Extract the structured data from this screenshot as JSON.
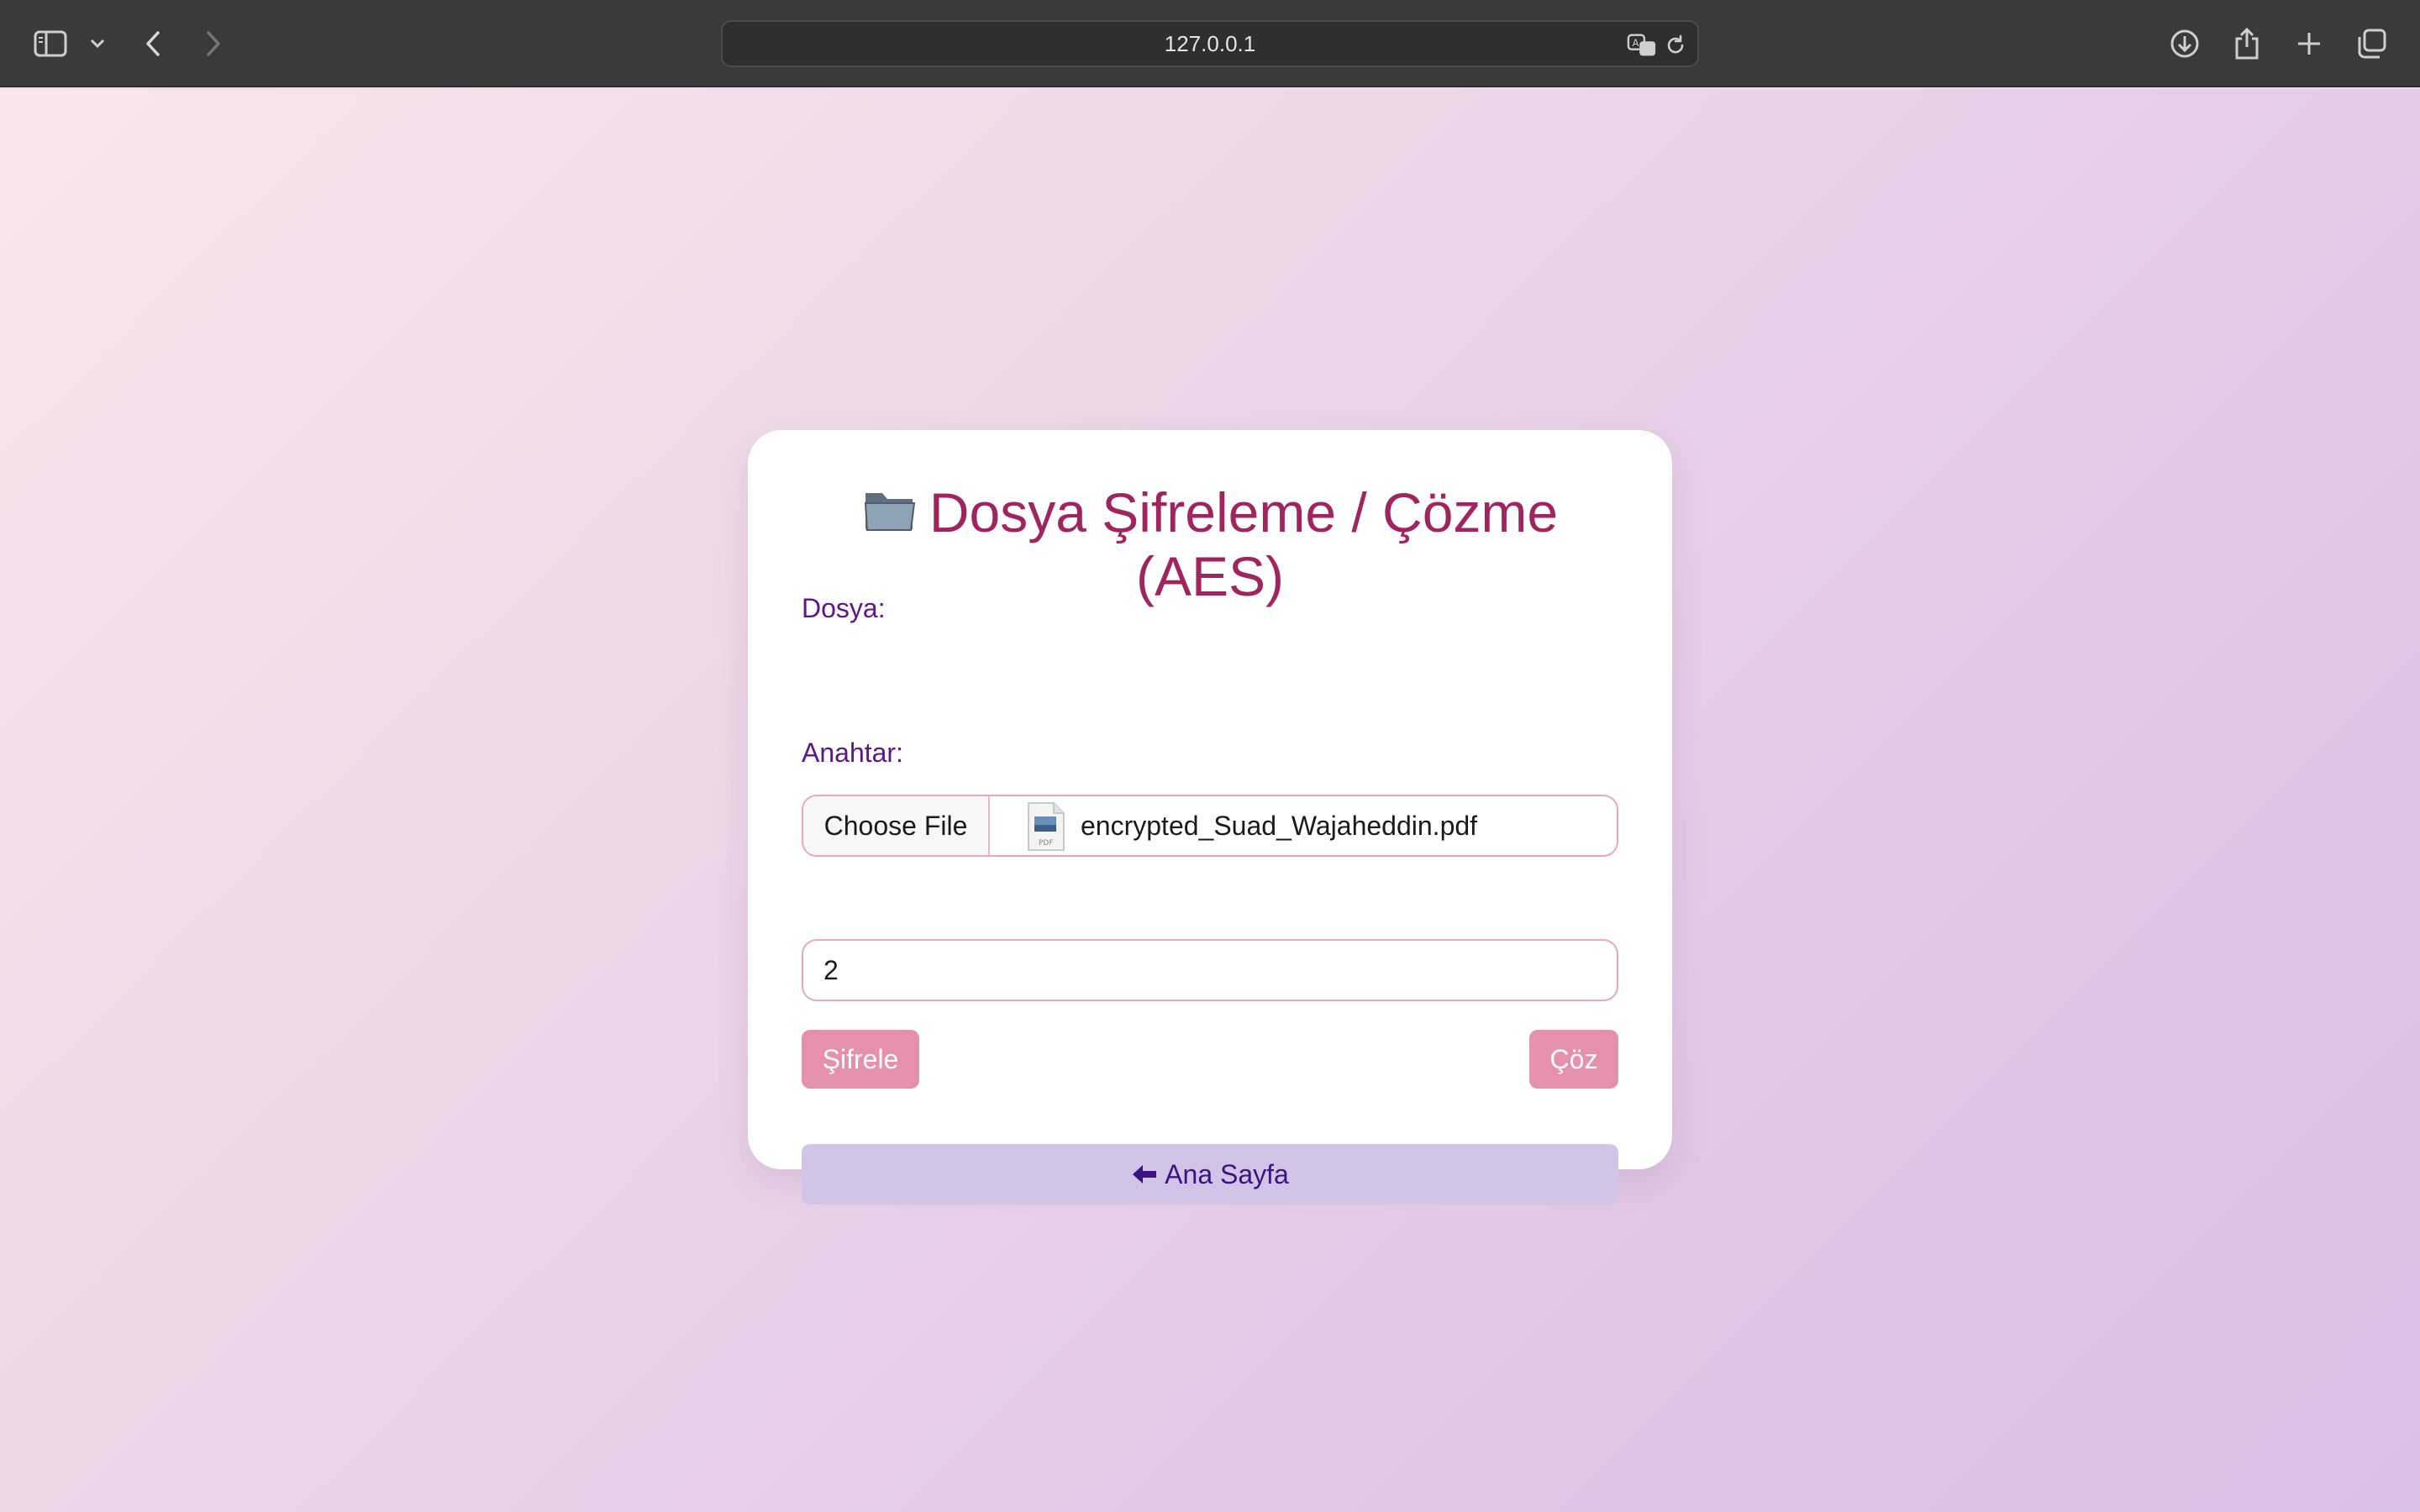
{
  "browser": {
    "address": "127.0.0.1",
    "icons": [
      "sidebar-icon",
      "chevron-down-icon",
      "back-icon",
      "forward-icon",
      "translate-icon",
      "reload-icon",
      "download-icon",
      "share-icon",
      "new-tab-icon",
      "tabs-overview-icon"
    ]
  },
  "page": {
    "title_icon": "folder-icon",
    "title": "Dosya Şifreleme / Çözme (AES)",
    "file_label": "Dosya:",
    "choose_file_label": "Choose File",
    "file_icon": "pdf-file-icon",
    "selected_file": "encrypted_Suad_Wajaheddin.pdf",
    "key_label": "Anahtar:",
    "key_value": "2",
    "encrypt_label": "Şifrele",
    "decrypt_label": "Çöz",
    "home_icon": "arrow-left-icon",
    "home_label": "Ana Sayfa"
  },
  "colors": {
    "title": "#a0255f",
    "label": "#5b1687",
    "action_button": "#e691ab",
    "home_button": "#d1c4e7",
    "field_border": "#e8a7bf"
  }
}
